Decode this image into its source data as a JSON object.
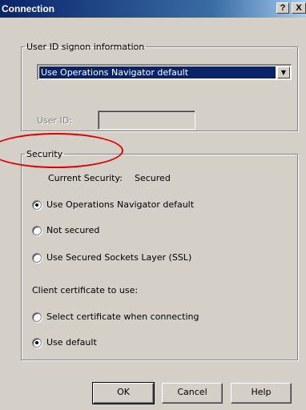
{
  "window": {
    "title": "Connection",
    "help_glyph": "?",
    "close_glyph": "X"
  },
  "userid_group": {
    "legend": "User ID signon information",
    "signon_select": "Use Operations Navigator default",
    "userid_label": "User ID:",
    "userid_value": ""
  },
  "security_group": {
    "legend": "Security",
    "current_security_label": "Current Security:",
    "current_security_value": "Secured",
    "options": [
      {
        "label": "Use Operations Navigator default",
        "checked": true
      },
      {
        "label": "Not secured",
        "checked": false
      },
      {
        "label": "Use Secured Sockets Layer (SSL)",
        "checked": false
      }
    ],
    "cert_label": "Client certificate to use:",
    "cert_options": [
      {
        "label": "Select certificate when connecting",
        "checked": false
      },
      {
        "label": "Use default",
        "checked": true
      }
    ]
  },
  "buttons": {
    "ok": "OK",
    "cancel": "Cancel",
    "help": "Help"
  },
  "colors": {
    "titlebar": "#0a246a",
    "dialog_face": "#d4d0c8",
    "selection": "#0a246a",
    "annotation": "#e00000"
  }
}
